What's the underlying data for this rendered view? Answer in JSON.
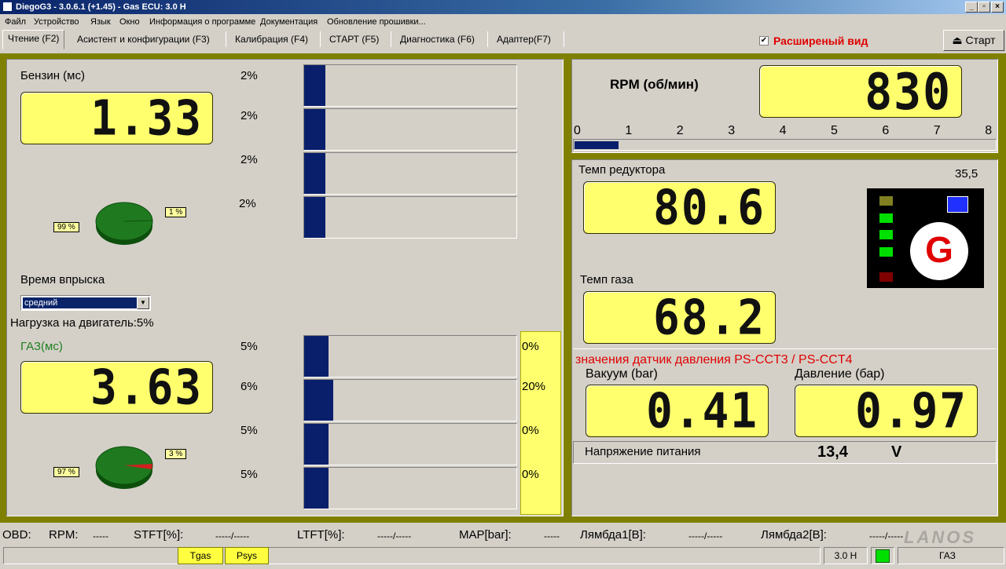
{
  "window": {
    "title": "DiegoG3 - 3.0.6.1 (+1.45) - Gas ECU: 3.0 H"
  },
  "menu": [
    "Файл",
    "Устройство",
    "Язык",
    "Окно",
    "Информация о программе",
    "Документация",
    "Обновление прошивки..."
  ],
  "tabs": [
    "Чтение (F2)",
    "Асистент и конфигурации (F3)",
    "Калибрация (F4)",
    "СТАРТ (F5)",
    "Диагностика (F6)",
    "Адаптер(F7)"
  ],
  "extended_view": {
    "label": "Расширеный вид",
    "checked": true,
    "check_glyph": "✔"
  },
  "start_button": {
    "label": "Старт",
    "icon": "eject-icon",
    "glyph": "⏏"
  },
  "petrol": {
    "label": "Бензин (мс)",
    "value": "1.33",
    "pie": {
      "left": "99 %",
      "right": "1 %"
    },
    "bars": [
      {
        "label": "2%",
        "value": 2
      },
      {
        "label": "2%",
        "value": 2
      },
      {
        "label": "2%",
        "value": 2
      },
      {
        "label": "2%",
        "value": 2
      }
    ]
  },
  "injection": {
    "label": "Время впрыска",
    "selected": "средний",
    "arrow": "▼"
  },
  "engine_load": "Нагрузка на двигатель:5%",
  "gas": {
    "label": "ГАЗ(мс)",
    "value": "3.63",
    "pie": {
      "left": "97 %",
      "right": "3 %"
    },
    "bars": [
      {
        "label": "5%",
        "value": 5
      },
      {
        "label": "6%",
        "value": 6
      },
      {
        "label": "5%",
        "value": 5
      },
      {
        "label": "5%",
        "value": 5
      }
    ],
    "yellow_column": [
      "0%",
      "20%",
      "0%",
      "0%"
    ]
  },
  "rpm": {
    "label": "RPM (об/мин)",
    "value": "830",
    "scale": [
      "0",
      "1",
      "2",
      "3",
      "4",
      "5",
      "6",
      "7",
      "8"
    ],
    "fill_fraction": 0.104
  },
  "reducer_temp": {
    "label": "Темп редуктора",
    "value": "80.6",
    "corner": "35,5"
  },
  "gas_temp": {
    "label": "Темп газа",
    "value": "68.2"
  },
  "indicator": {
    "letter": "G",
    "leds": [
      "#808020",
      "#00e000",
      "#00e000",
      "#00e000",
      "#00e000",
      "#800000"
    ],
    "square": "#2030ff"
  },
  "pressure": {
    "caption": "значения датчик давления PS-CCT3 / PS-CCT4",
    "vacuum_label": "Вакуум (bar)",
    "vacuum_value": "0.41",
    "pressure_label": "Давление (бар)",
    "pressure_value": "0.97"
  },
  "voltage": {
    "label": "Напряжение питания",
    "value": "13,4",
    "unit": "V"
  },
  "obd": [
    {
      "label": "OBD:",
      "value": ""
    },
    {
      "label": "RPM:",
      "value": "-----"
    },
    {
      "label": "STFT[%]:",
      "value": "-----/-----"
    },
    {
      "label": "LTFT[%]:",
      "value": "-----/-----"
    },
    {
      "label": "MAP[bar]:",
      "value": "-----"
    },
    {
      "label": "Лямбда1[B]:",
      "value": "-----/-----"
    },
    {
      "label": "Лямбда2[B]:",
      "value": "-----/-----"
    }
  ],
  "status": {
    "tgas": "Tgas",
    "psys": "Psys",
    "ecu": "3.0 H",
    "fuel": "ГАЗ",
    "watermark": "LANOS"
  },
  "colors": {
    "lcd": "#ffff6e",
    "olive": "#808000",
    "bar": "#0a1f6b",
    "pie": "#1f7a1f"
  }
}
